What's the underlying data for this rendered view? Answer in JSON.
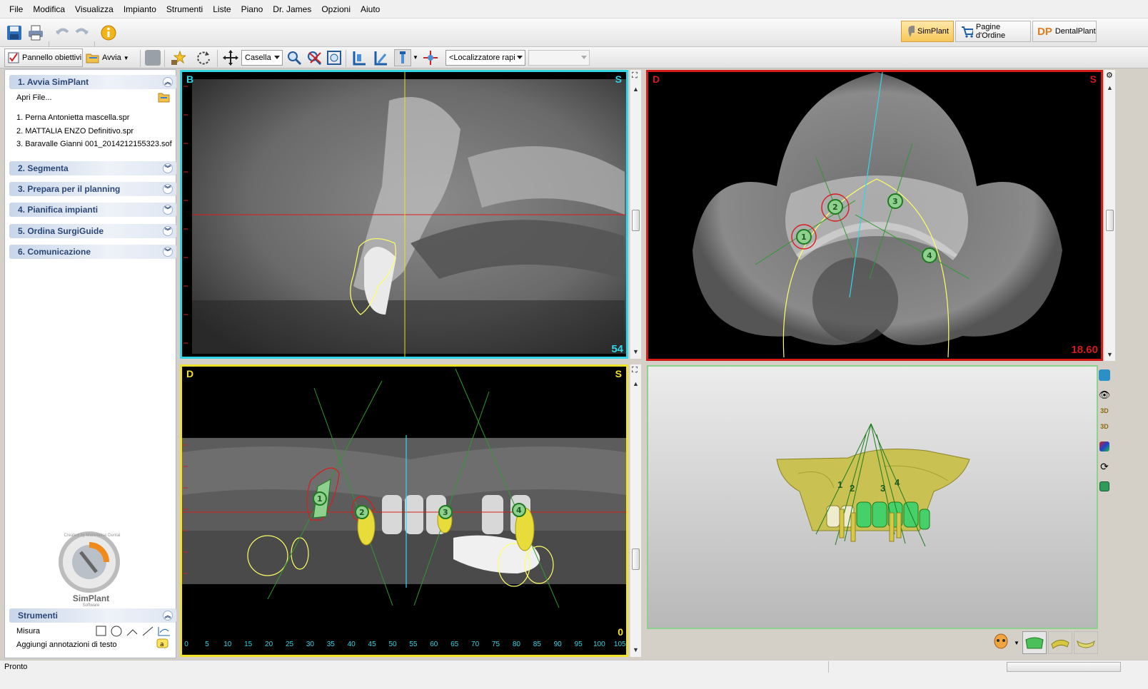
{
  "menu": [
    "File",
    "Modifica",
    "Visualizza",
    "Impianto",
    "Strumenti",
    "Liste",
    "Piano",
    "Dr. James",
    "Opzioni",
    "Aiuto"
  ],
  "toolbar": {
    "icons": [
      "save-icon",
      "print-icon",
      "undo-icon",
      "redo-icon",
      "info-icon"
    ],
    "pannello_label": "Pannello obiettivi",
    "avvia_label": "Avvia",
    "casella_value": "Casella",
    "localizzatore_value": "<Localizzatore rapi",
    "empty_combo_value": ""
  },
  "modes": {
    "simplant": "SimPlant",
    "pagine": "Pagine d'Ordine",
    "dentalplant": "DentalPlant",
    "dp_logo": "DP"
  },
  "left_panel": {
    "sections": [
      {
        "label": "1. Avvia SimPlant",
        "expanded": true
      },
      {
        "label": "2. Segmenta",
        "expanded": false
      },
      {
        "label": "3. Prepara per il planning",
        "expanded": false
      },
      {
        "label": "4. Pianifica impianti",
        "expanded": false
      },
      {
        "label": "5. Ordina SurgiGuide",
        "expanded": false
      },
      {
        "label": "6. Comunicazione",
        "expanded": false
      }
    ],
    "open_file": "Apri File...",
    "recent_files": [
      "1. Perna Antonietta mascella.spr",
      "2. MATTALIA ENZO Definitivo.spr",
      "3. Baravalle Gianni 001_2014212155323.sof"
    ],
    "logo": {
      "brand": "SimPlant",
      "sub": "Software",
      "ring_text": "Created by Materialise Dental"
    },
    "tools_header": "Strumenti",
    "tools": [
      {
        "label": "Misura"
      },
      {
        "label": "Aggiungi annotazioni di testo"
      }
    ]
  },
  "views": {
    "sagittal": {
      "top_left": "B",
      "top_right": "S",
      "slice": "54",
      "border_color": "#33d6e6"
    },
    "axial": {
      "top_left": "D",
      "top_right": "S",
      "slice": "18.60",
      "border_color": "#d51a1a"
    },
    "panoramic": {
      "top_left": "D",
      "top_right": "S",
      "slice": "0",
      "border_color": "#f0e22a",
      "scale_labels": [
        "0",
        "5",
        "10",
        "15",
        "20",
        "25",
        "30",
        "35",
        "40",
        "45",
        "50",
        "55",
        "60",
        "65",
        "70",
        "75",
        "80",
        "85",
        "90",
        "95",
        "100",
        "105"
      ]
    },
    "three_d": {
      "border_color": "#8fd08f"
    }
  },
  "implants": {
    "axial": [
      "1",
      "2",
      "3",
      "4"
    ],
    "panoramic": [
      "1",
      "2",
      "3",
      "4"
    ],
    "three_d": [
      "1",
      "2",
      "3",
      "4"
    ]
  },
  "status": {
    "text": "Pronto"
  }
}
